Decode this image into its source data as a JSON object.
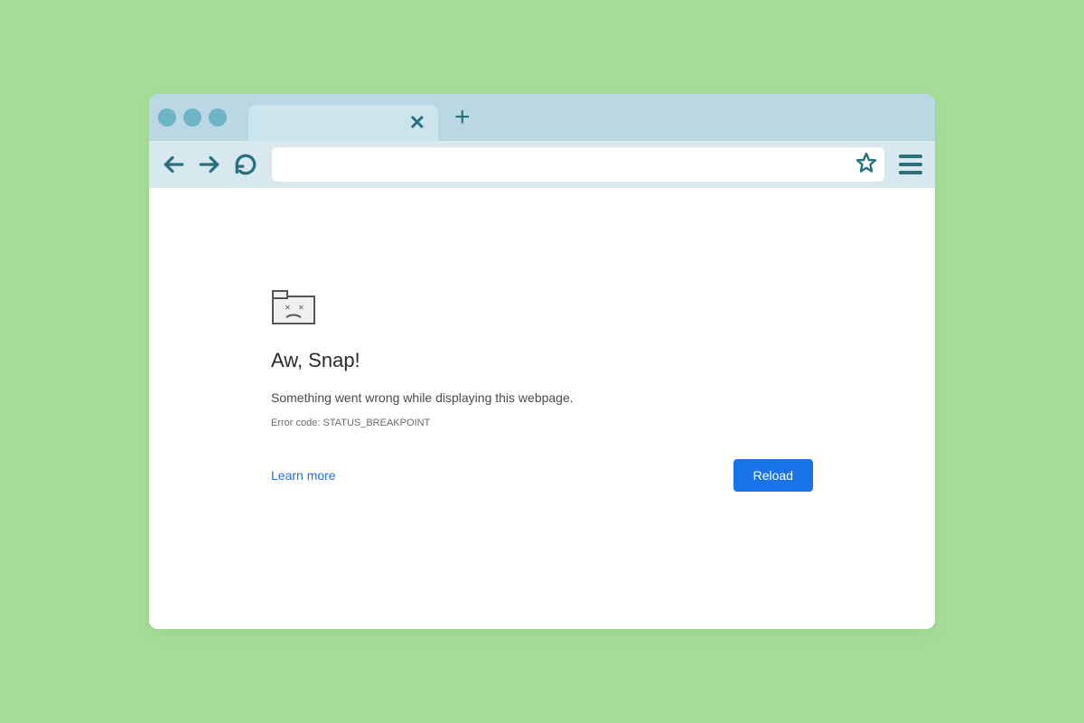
{
  "address_bar": {
    "value": ""
  },
  "error": {
    "title": "Aw, Snap!",
    "message": "Something went wrong while displaying this webpage.",
    "code_label": "Error code: STATUS_BREAKPOINT",
    "learn_more_label": "Learn more",
    "reload_label": "Reload"
  }
}
